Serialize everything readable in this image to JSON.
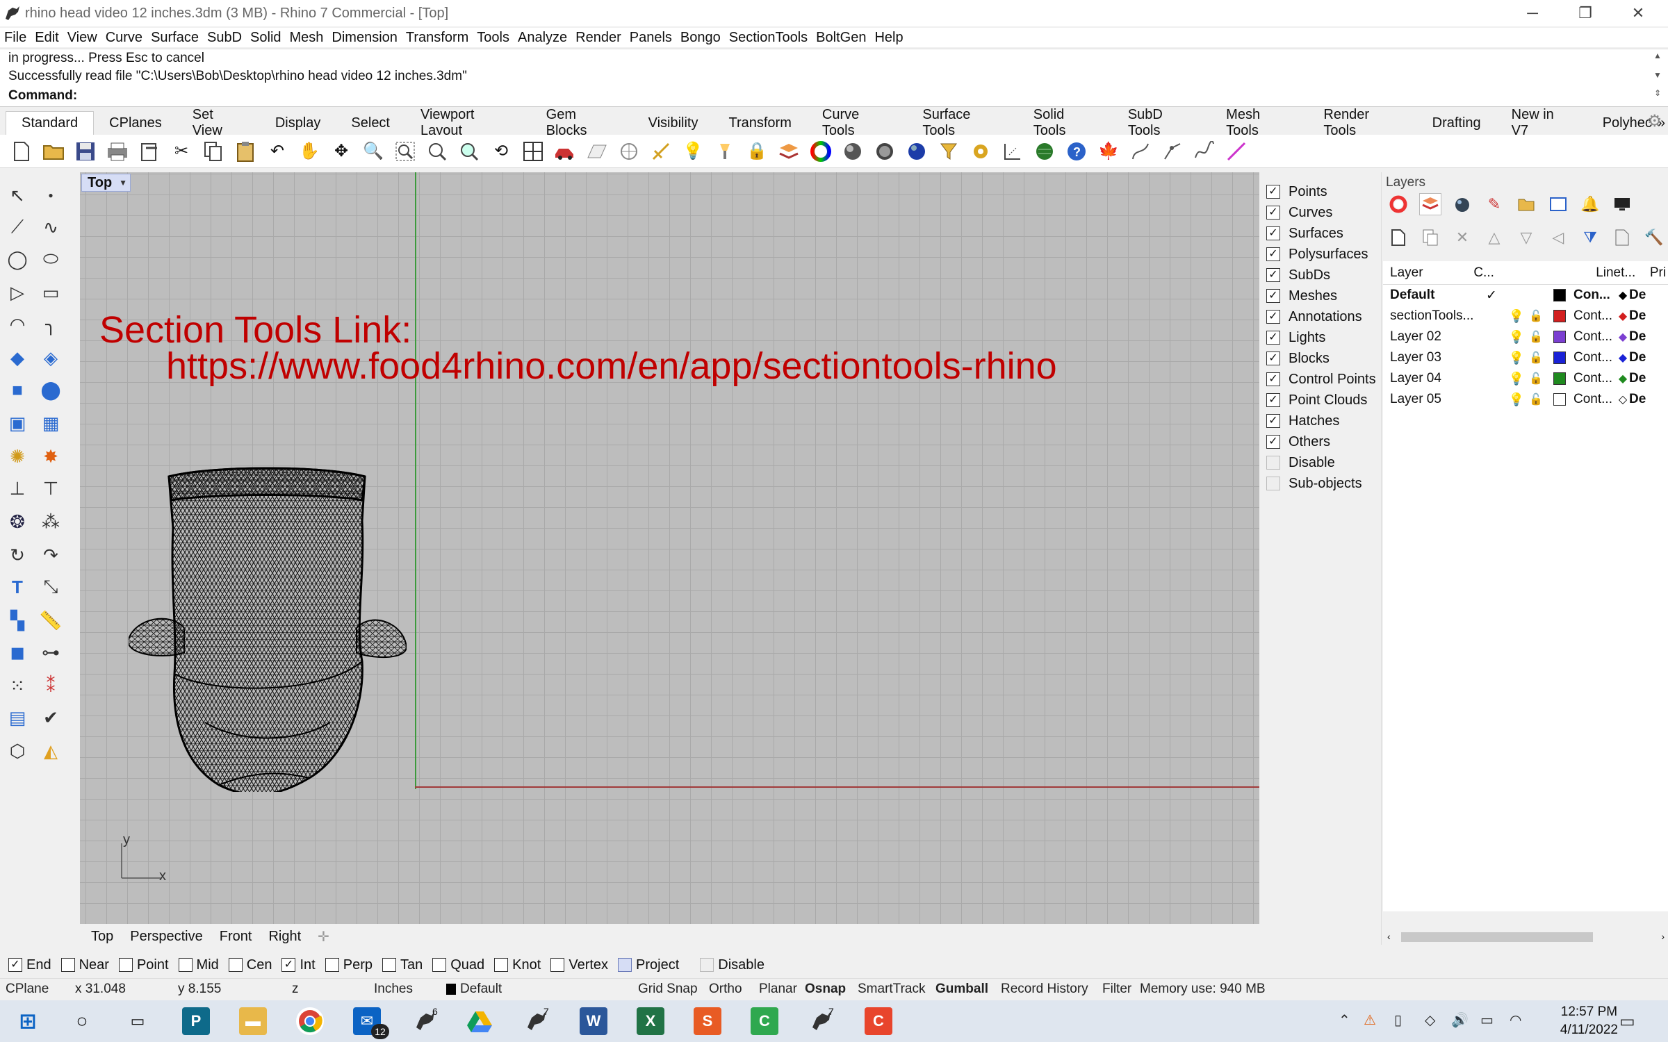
{
  "window": {
    "title": "rhino head video 12 inches.3dm (3 MB) - Rhino 7 Commercial - [Top]",
    "controls": [
      "─",
      "❐",
      "✕"
    ]
  },
  "menu": [
    "File",
    "Edit",
    "View",
    "Curve",
    "Surface",
    "SubD",
    "Solid",
    "Mesh",
    "Dimension",
    "Transform",
    "Tools",
    "Analyze",
    "Render",
    "Panels",
    "Bongo",
    "SectionTools",
    "BoltGen",
    "Help"
  ],
  "command": {
    "history": [
      "in progress... Press Esc to cancel",
      "Successfully read file \"C:\\Users\\Bob\\Desktop\\rhino head video 12 inches.3dm\""
    ],
    "label": "Command:",
    "value": ""
  },
  "toolbar_tabs": [
    "Standard",
    "CPlanes",
    "Set View",
    "Display",
    "Select",
    "Viewport Layout",
    "Gem Blocks",
    "Visibility",
    "Transform",
    "Curve Tools",
    "Surface Tools",
    "Solid Tools",
    "SubD Tools",
    "Mesh Tools",
    "Render Tools",
    "Drafting",
    "New in V7",
    "Polyhec"
  ],
  "tabs_overflow": "»",
  "toolbar_icons": [
    "new-file",
    "open-file",
    "save",
    "print",
    "import",
    "cut",
    "copy",
    "paste",
    "undo",
    "pan",
    "rotate-view",
    "zoom",
    "zoom-window",
    "zoom-extents",
    "zoom-selected",
    "rotate-camera",
    "four-viewports",
    "car-vehicle",
    "grid-plane",
    "set-cplane",
    "snap",
    "light-bulb",
    "lamp",
    "lock",
    "layer",
    "color-wheel",
    "display-shaded",
    "display-rendered",
    "sphere",
    "filter",
    "gear",
    "dimensions",
    "world",
    "help",
    "maple-leaf",
    "curve-tool",
    "curve-tool-2",
    "spline",
    "line"
  ],
  "viewport": {
    "name": "Top",
    "annotation": {
      "line1": "Section Tools Link:",
      "line2": "https://www.food4rhino.com/en/app/sectiontools-rhino"
    },
    "axis_x": "x",
    "axis_y": "y"
  },
  "display_filter": [
    {
      "label": "Points",
      "checked": true
    },
    {
      "label": "Curves",
      "checked": true
    },
    {
      "label": "Surfaces",
      "checked": true
    },
    {
      "label": "Polysurfaces",
      "checked": true
    },
    {
      "label": "SubDs",
      "checked": true
    },
    {
      "label": "Meshes",
      "checked": true
    },
    {
      "label": "Annotations",
      "checked": true
    },
    {
      "label": "Lights",
      "checked": true
    },
    {
      "label": "Blocks",
      "checked": true
    },
    {
      "label": "Control Points",
      "checked": true
    },
    {
      "label": "Point Clouds",
      "checked": true
    },
    {
      "label": "Hatches",
      "checked": true
    },
    {
      "label": "Others",
      "checked": true
    },
    {
      "label": "Disable",
      "checked": false
    },
    {
      "label": "Sub-objects",
      "checked": false
    }
  ],
  "layers": {
    "title": "Layers",
    "columns": [
      "Layer",
      "C...",
      "Linet...",
      "Pri"
    ],
    "rows": [
      {
        "name": "Default",
        "current": "✓",
        "color": "#000000",
        "linetype": "Con...",
        "print": "De",
        "bold": true,
        "showIcons": false
      },
      {
        "name": "sectionTools...",
        "current": "",
        "color": "#d21f1f",
        "linetype": "Cont...",
        "print": "De",
        "bold": false,
        "showIcons": true
      },
      {
        "name": "Layer 02",
        "current": "",
        "color": "#7b3fd1",
        "linetype": "Cont...",
        "print": "De",
        "bold": false,
        "showIcons": true
      },
      {
        "name": "Layer 03",
        "current": "",
        "color": "#1a22d6",
        "linetype": "Cont...",
        "print": "De",
        "bold": false,
        "showIcons": true
      },
      {
        "name": "Layer 04",
        "current": "",
        "color": "#1f8a1f",
        "linetype": "Cont...",
        "print": "De",
        "bold": false,
        "showIcons": true
      },
      {
        "name": "Layer 05",
        "current": "",
        "color": "#ffffff",
        "linetype": "Cont...",
        "print": "De",
        "bold": false,
        "showIcons": true
      }
    ]
  },
  "viewport_tabs": [
    "Top",
    "Perspective",
    "Front",
    "Right"
  ],
  "osnaps": [
    {
      "label": "End",
      "checked": true
    },
    {
      "label": "Near",
      "checked": false
    },
    {
      "label": "Point",
      "checked": false
    },
    {
      "label": "Mid",
      "checked": false
    },
    {
      "label": "Cen",
      "checked": false
    },
    {
      "label": "Int",
      "checked": true
    },
    {
      "label": "Perp",
      "checked": false
    },
    {
      "label": "Tan",
      "checked": false
    },
    {
      "label": "Quad",
      "checked": false
    },
    {
      "label": "Knot",
      "checked": false
    },
    {
      "label": "Vertex",
      "checked": false
    },
    {
      "label": "Project",
      "checked": false
    },
    {
      "label": "Disable",
      "checked": false
    }
  ],
  "status": {
    "cplane": "CPlane",
    "x": "x 31.048",
    "y": "y 8.155",
    "z": "z",
    "units": "Inches",
    "layer": "Default",
    "grid_snap": "Grid Snap",
    "ortho": "Ortho",
    "planar": "Planar",
    "osnap": "Osnap",
    "smarttrack": "SmartTrack",
    "gumball": "Gumball",
    "record_history": "Record History",
    "filter": "Filter",
    "memory": "Memory use: 940 MB"
  },
  "taskbar": {
    "mail_badge": "12",
    "rhino6": "6",
    "rhino7": "7",
    "time": "12:57 PM",
    "date": "4/11/2022"
  }
}
